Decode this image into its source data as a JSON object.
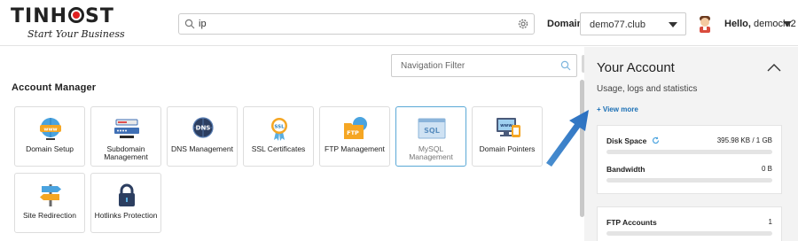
{
  "brand": {
    "name_left": "TIN",
    "name_right": "H",
    "name_end": "ST",
    "tagline": "Start Your Business"
  },
  "search": {
    "value": "ip"
  },
  "domain": {
    "label": "Domain",
    "selected": "demo77.club"
  },
  "user": {
    "greeting": "Hello,",
    "name": "democlu2"
  },
  "nav_filter": {
    "placeholder": "Navigation Filter"
  },
  "section": {
    "title": "Account Manager"
  },
  "tiles": [
    {
      "label": "Domain Setup",
      "icon": "www-globe-icon"
    },
    {
      "label": "Subdomain Management",
      "icon": "subdomain-icon"
    },
    {
      "label": "DNS Management",
      "icon": "dns-icon"
    },
    {
      "label": "SSL Certificates",
      "icon": "ssl-badge-icon"
    },
    {
      "label": "FTP Management",
      "icon": "ftp-folder-icon"
    },
    {
      "label": "MySQL Management",
      "icon": "sql-window-icon"
    },
    {
      "label": "Domain Pointers",
      "icon": "domain-pointer-icon"
    },
    {
      "label": "Site Redirection",
      "icon": "signpost-icon"
    },
    {
      "label": "Hotlinks Protection",
      "icon": "padlock-icon"
    }
  ],
  "account": {
    "title": "Your Account",
    "subtitle": "Usage, logs and statistics",
    "view_more": "+ View more",
    "stats": [
      {
        "label": "Disk Space",
        "value": "395.98 KB / 1 GB",
        "fill": 0.0004
      },
      {
        "label": "Bandwidth",
        "value": "0 B",
        "fill": 0
      },
      {
        "label": "FTP Accounts",
        "value": "1",
        "fill": 0
      }
    ]
  },
  "colors": {
    "accent": "#3f8ed1",
    "logo_red": "#e02020",
    "link": "#1a6fb5",
    "active_border": "#5aa8d6"
  }
}
